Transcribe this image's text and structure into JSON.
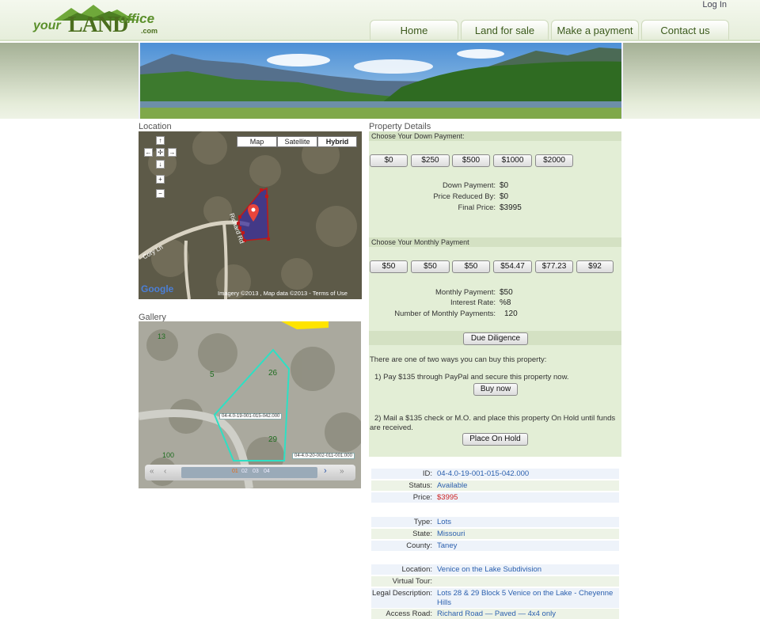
{
  "header": {
    "logo": {
      "your": "your",
      "land": "LAND",
      "office": "office",
      "com": ".com"
    },
    "login_label": "Log In",
    "nav": [
      "Home",
      "Land for sale",
      "Make a payment",
      "Contact us"
    ]
  },
  "location_label": "Location",
  "map": {
    "types": [
      "Map",
      "Satellite",
      "Hybrid"
    ],
    "selected_type": "Hybrid",
    "road_labels": [
      "Cory Ln",
      "Richard Rd"
    ],
    "attribution": "Imagery ©2013 , Map data ©2013 - Terms of Use",
    "brand": "Google"
  },
  "gallery_label": "Gallery",
  "gallery": {
    "pages": [
      "01",
      "02",
      "03",
      "04"
    ],
    "current_page": "01",
    "parcel_labels": [
      "04-4.0-19-001-015-042.000",
      "04-4.0-20-002-011-001.000"
    ]
  },
  "details_label": "Property Details",
  "down_payment": {
    "heading": "Choose Your Down Payment:",
    "options": [
      "$0",
      "$250",
      "$500",
      "$1000",
      "$2000"
    ],
    "down_label": "Down Payment:",
    "down_value": "$0",
    "reduced_label": "Price Reduced By:",
    "reduced_value": "$0",
    "final_label": "Final Price:",
    "final_value": "$3995"
  },
  "monthly_payment": {
    "heading": "Choose Your Monthly Payment",
    "options": [
      "$50",
      "$50",
      "$50",
      "$54.47",
      "$77.23",
      "$92"
    ],
    "monthly_label": "Monthly Payment:",
    "monthly_value": "$50",
    "rate_label": "Interest Rate:",
    "rate_value": "%8",
    "num_label": "Number of Monthly Payments:",
    "num_value": "120"
  },
  "due_diligence_label": "Due Diligence",
  "purchase": {
    "intro": "There are one of two ways you can buy this property:",
    "option1": "1) Pay $135 through PayPal and secure this property now.",
    "buy_label": "Buy now",
    "option2": "2) Mail a $135 check or M.O. and place this property On Hold until funds are received.",
    "hold_label": "Place On Hold"
  },
  "info": {
    "id_label": "ID:",
    "id_value": "04-4.0-19-001-015-042.000",
    "status_label": "Status:",
    "status_value": "Available",
    "price_label": "Price:",
    "price_value": "$3995",
    "type_label": "Type:",
    "type_value": "Lots",
    "state_label": "State:",
    "state_value": "Missouri",
    "county_label": "County:",
    "county_value": "Taney",
    "location_label": "Location:",
    "location_value": "Venice on the Lake Subdivision",
    "tour_label": "Virtual Tour:",
    "tour_value": "",
    "legal_label": "Legal Description:",
    "legal_value": "Lots 28 & 29 Block 5 Venice on the Lake - Cheyenne Hills",
    "access_label": "Access Road:",
    "access_value": "Richard Road — Paved — 4x4 only"
  },
  "colors": {
    "accent": "#4b6e1e",
    "link": "#2a5fae",
    "price": "#cc2222",
    "panel": "#e3eed6"
  }
}
